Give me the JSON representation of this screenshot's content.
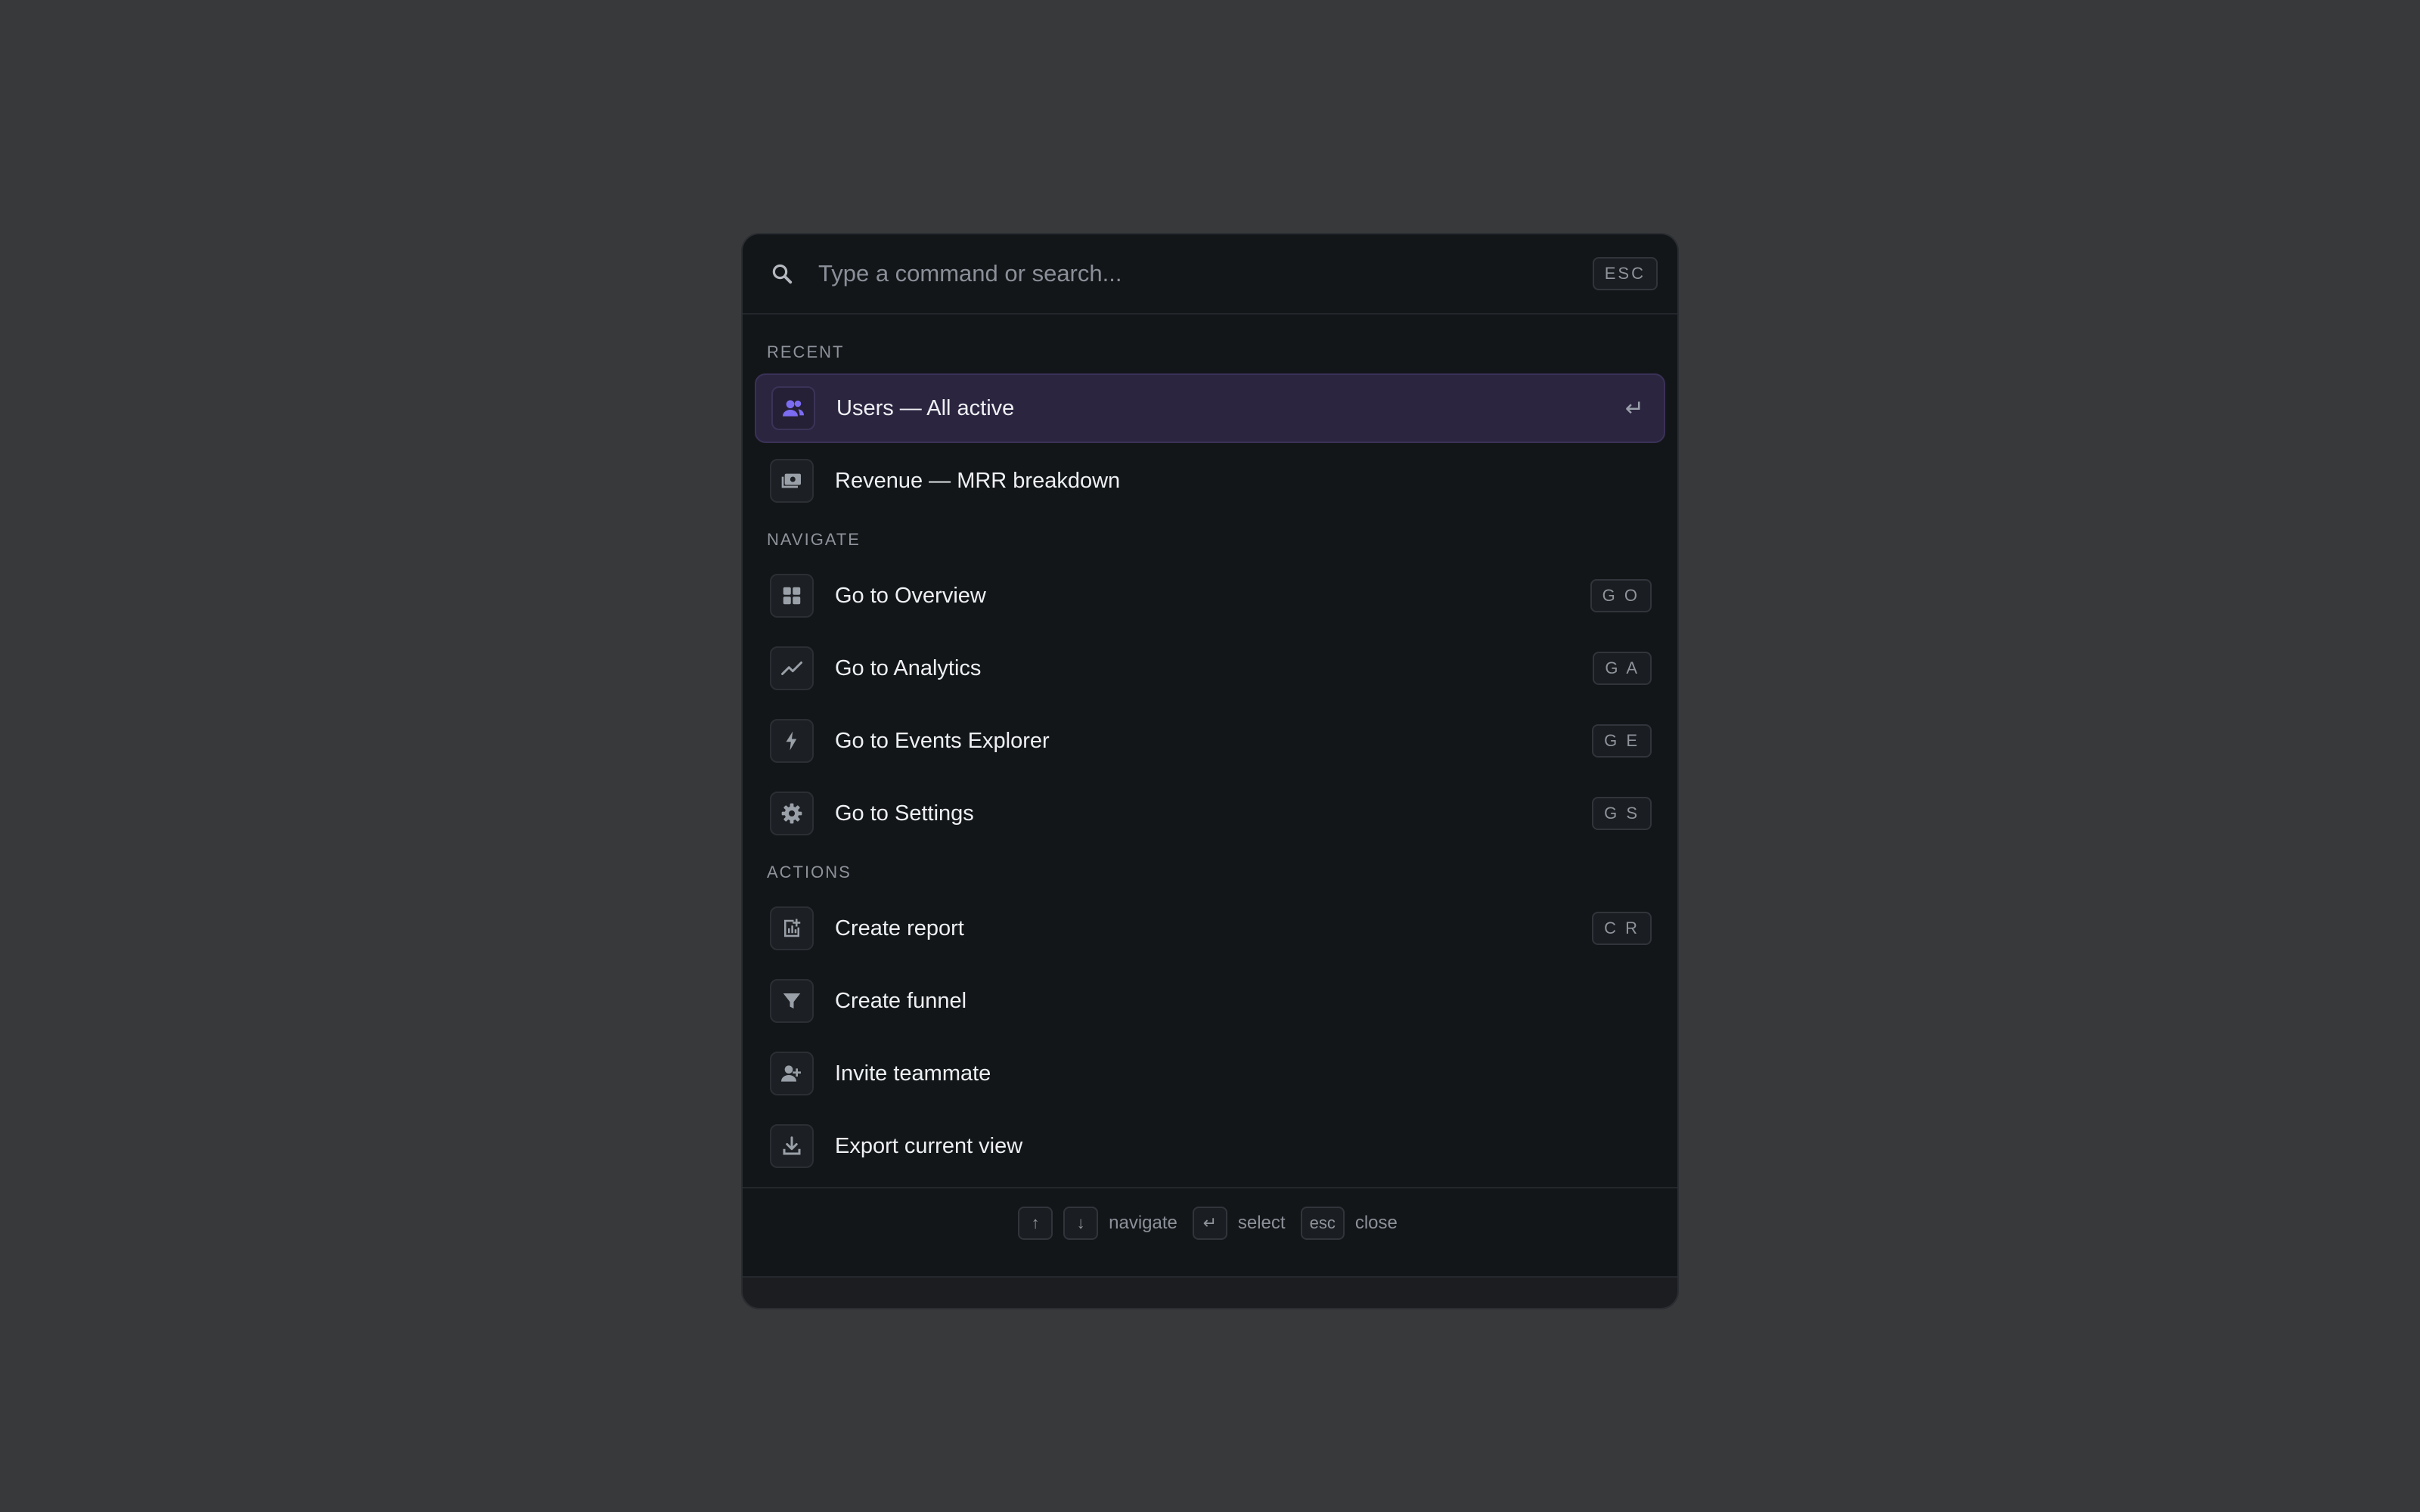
{
  "search": {
    "placeholder": "Type a command or search...",
    "esc_label": "ESC"
  },
  "sections": {
    "recent": "RECENT",
    "navigate": "NAVIGATE",
    "actions": "ACTIONS"
  },
  "recent": [
    {
      "label": "Users — All active",
      "icon": "users-icon",
      "enter": "↵"
    },
    {
      "label": "Revenue — MRR breakdown",
      "icon": "money-icon"
    }
  ],
  "navigate": [
    {
      "label": "Go to Overview",
      "icon": "grid-icon",
      "shortcut": "G O"
    },
    {
      "label": "Go to Analytics",
      "icon": "trend-icon",
      "shortcut": "G A"
    },
    {
      "label": "Go to Events Explorer",
      "icon": "bolt-icon",
      "shortcut": "G E"
    },
    {
      "label": "Go to Settings",
      "icon": "gear-icon",
      "shortcut": "G S"
    }
  ],
  "actions": [
    {
      "label": "Create report",
      "icon": "report-icon",
      "shortcut": "C R"
    },
    {
      "label": "Create funnel",
      "icon": "funnel-icon"
    },
    {
      "label": "Invite teammate",
      "icon": "user-plus-icon"
    },
    {
      "label": "Export current view",
      "icon": "download-icon"
    }
  ],
  "footer": {
    "up": "↑",
    "down": "↓",
    "navigate": "navigate",
    "enter": "↵",
    "select": "select",
    "esc": "esc",
    "close": "close"
  },
  "colors": {
    "accent": "#7c6cf2",
    "icon": "#9aa0a8"
  }
}
